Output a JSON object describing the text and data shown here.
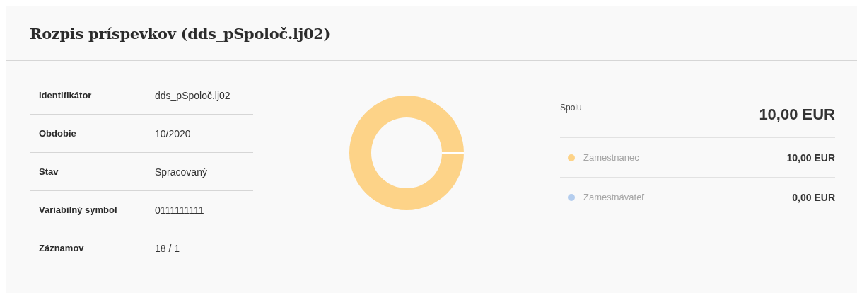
{
  "title": "Rozpis príspevkov (dds_pSpoloč.lj02)",
  "details": [
    {
      "label": "Identifikátor",
      "value": "dds_pSpoloč.lj02"
    },
    {
      "label": "Obdobie",
      "value": "10/2020"
    },
    {
      "label": "Stav",
      "value": "Spracovaný"
    },
    {
      "label": "Variabilný symbol",
      "value": "0111111111"
    },
    {
      "label": "Záznamov",
      "value": "18 / 1"
    }
  ],
  "summary": {
    "total_label": "Spolu",
    "total_value": "10,00 EUR",
    "items": [
      {
        "label": "Zamestnanec",
        "value": "10,00 EUR",
        "color": "#fdd388"
      },
      {
        "label": "Zamestnávateľ",
        "value": "0,00 EUR",
        "color": "#b4cdee"
      }
    ]
  }
}
